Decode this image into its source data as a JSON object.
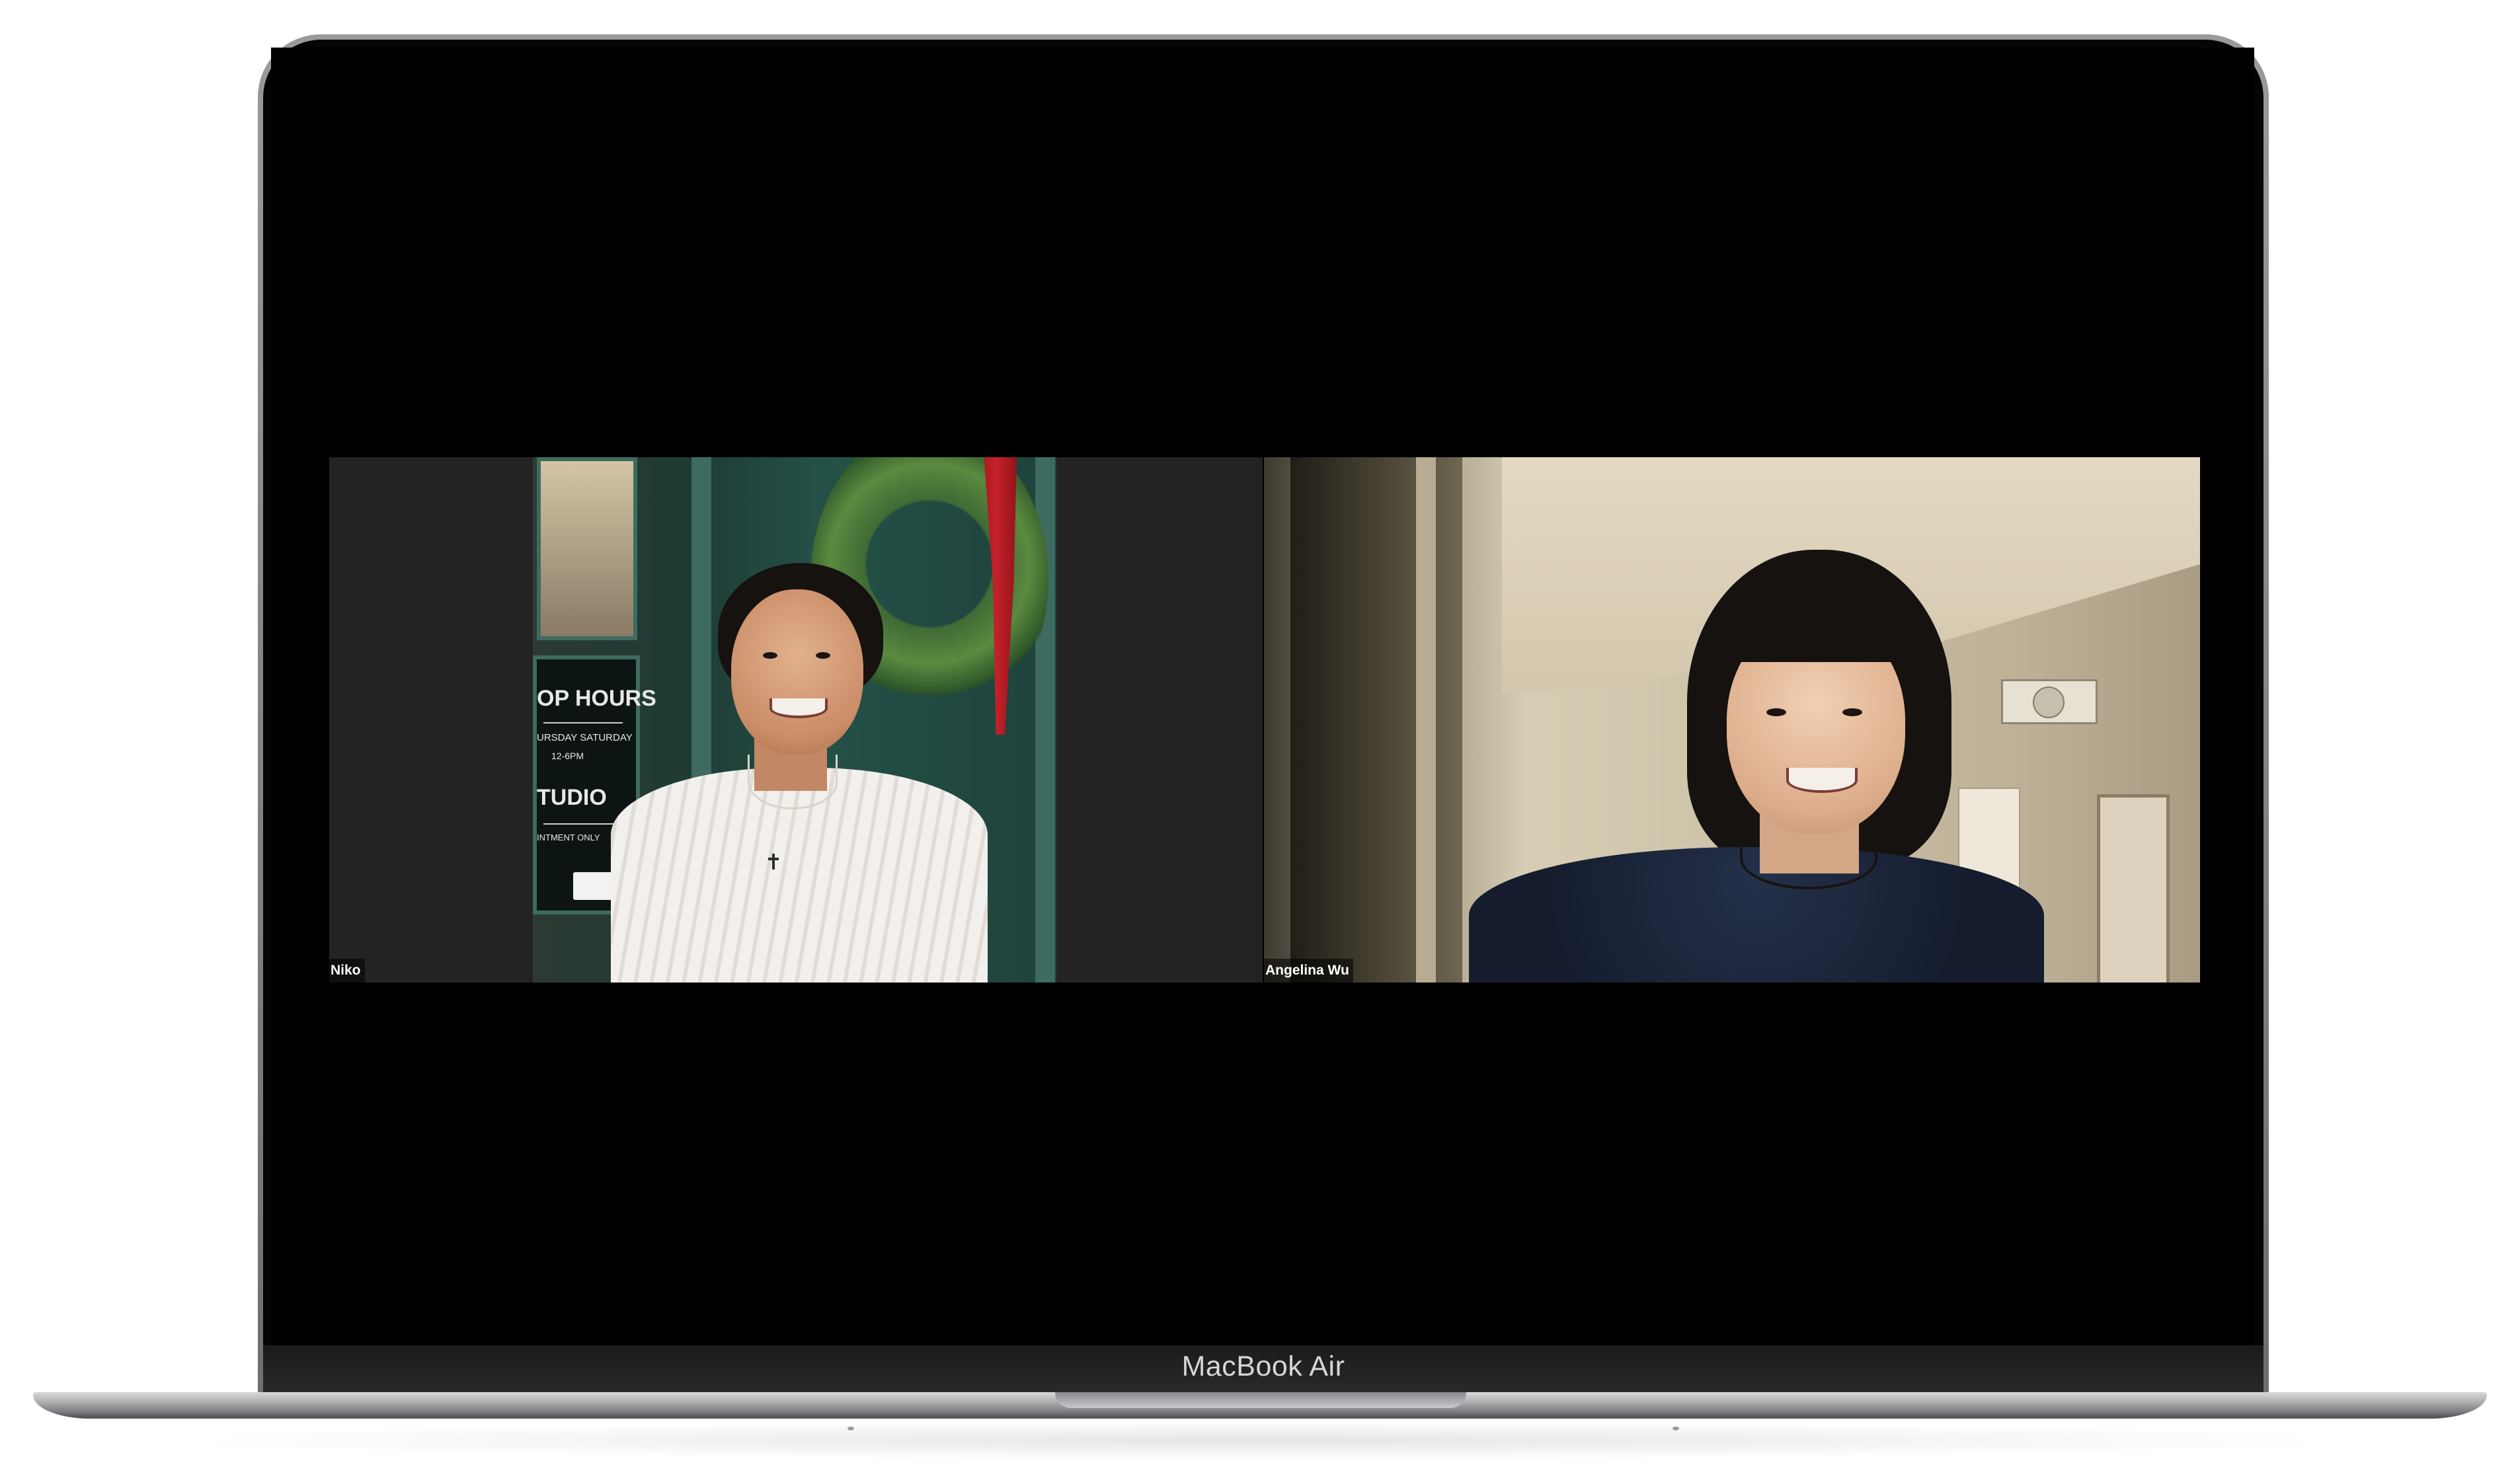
{
  "device": {
    "model_label": "MacBook Air"
  },
  "video_call": {
    "participants": [
      {
        "name": "Niko"
      },
      {
        "name": "Angelina Wu"
      }
    ]
  },
  "scene_text": {
    "sign_line_1": "OP HOURS",
    "sign_line_2": "URSDAY SATURDAY",
    "sign_line_3": "12-6PM",
    "sign_line_4": "TUDIO",
    "sign_line_5": "INTMENT ONLY"
  },
  "colors": {
    "screen_background": "#000000",
    "tile_background": "#232323",
    "chassis_gray": "#7b7b7f"
  }
}
